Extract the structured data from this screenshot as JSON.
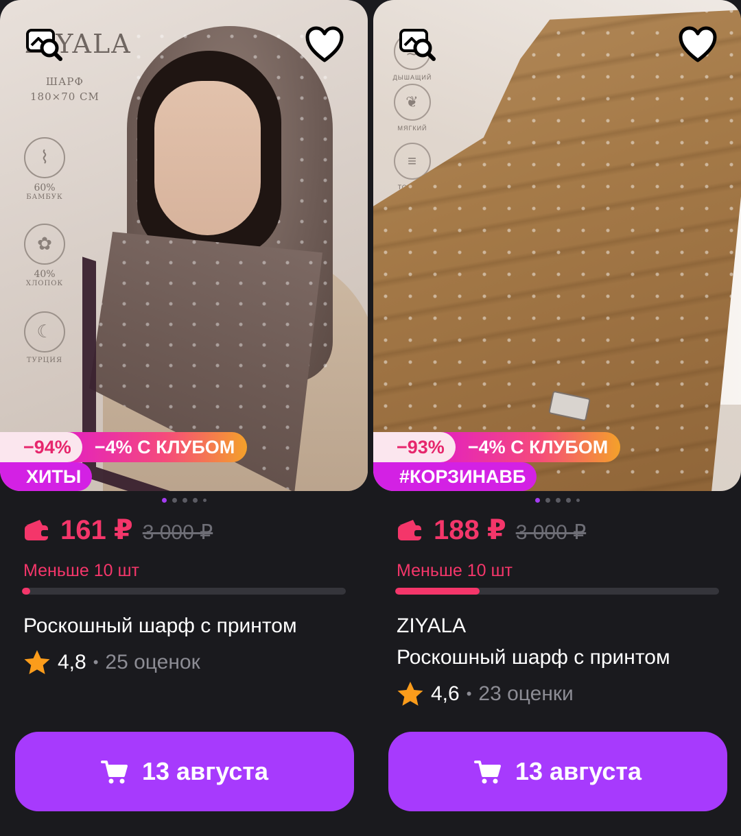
{
  "colors": {
    "background": "#1a1a1e",
    "accent": "#a73afd",
    "price": "#f4366a",
    "muted": "#8c8c94"
  },
  "products": [
    {
      "photo_text": {
        "brand": "ZIYALA",
        "item_type": "ШАРФ",
        "size": "180×70 СМ",
        "features": [
          {
            "value": "60%",
            "label": "БАМБУК",
            "icon": "bamboo-icon"
          },
          {
            "value": "40%",
            "label": "ХЛОПОК",
            "icon": "cotton-icon"
          },
          {
            "value": "",
            "label": "ТУРЦИЯ",
            "icon": "crescent-icon"
          }
        ]
      },
      "discount": "−94%",
      "club_discount": "−4% С КЛУБОМ",
      "tag": "ХИТЫ",
      "price": "161 ₽",
      "old_price": "3 000 ₽",
      "stock_text": "Меньше 10 шт",
      "stock_level": 0.02,
      "brand_line": "",
      "title": "Роскошный шарф с принтом",
      "rating": "4,8",
      "reviews": "25 оценок",
      "delivery": "13 августа",
      "slides": 5,
      "active_slide": 0
    },
    {
      "photo_text": {
        "features": [
          {
            "label": "ДЫШАЩИЙ",
            "icon": "wind-icon"
          },
          {
            "label": "МЯГКИЙ",
            "icon": "feather-icon"
          },
          {
            "label": "ТОНКИЙ",
            "icon": "layers-icon"
          }
        ]
      },
      "discount": "−93%",
      "club_discount": "−4% С КЛУБОМ",
      "tag": "#КОРЗИНАВБ",
      "price": "188 ₽",
      "old_price": "3 000 ₽",
      "stock_text": "Меньше 10 шт",
      "stock_level": 0.26,
      "brand_line": "ZIYALA",
      "title": "Роскошный шарф с принтом",
      "rating": "4,6",
      "reviews": "23 оценки",
      "delivery": "13 августа",
      "slides": 5,
      "active_slide": 0
    }
  ]
}
